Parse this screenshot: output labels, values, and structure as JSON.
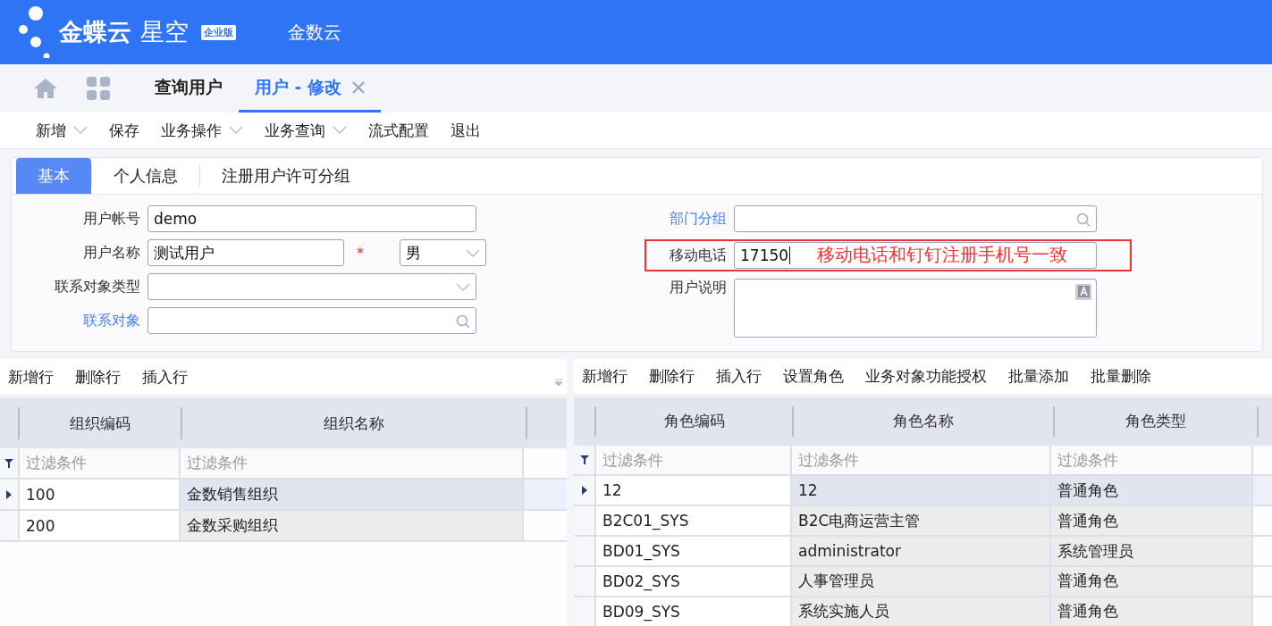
{
  "header": {
    "brand": "金蝶云",
    "product": "星空",
    "edition": "企业版",
    "org": "金数云"
  },
  "nav_tabs": [
    {
      "label": "查询用户",
      "selected": false,
      "closable": false
    },
    {
      "label": "用户 - 修改",
      "selected": true,
      "closable": true
    }
  ],
  "toolbar": [
    {
      "label": "新增",
      "dropdown": true
    },
    {
      "label": "保存",
      "dropdown": false
    },
    {
      "label": "业务操作",
      "dropdown": true
    },
    {
      "label": "业务查询",
      "dropdown": true
    },
    {
      "label": "流式配置",
      "dropdown": false
    },
    {
      "label": "退出",
      "dropdown": false
    }
  ],
  "form_tabs": [
    {
      "label": "基本",
      "selected": true
    },
    {
      "label": "个人信息",
      "selected": false
    },
    {
      "label": "注册用户许可分组",
      "selected": false
    }
  ],
  "form_left": [
    {
      "label": "用户帐号",
      "link": false,
      "kind": "text",
      "value": "demo"
    },
    {
      "label": "用户名称",
      "link": false,
      "kind": "text_with_select",
      "value": "测试用户",
      "required_mark": "*",
      "select_value": "男"
    },
    {
      "label": "联系对象类型",
      "link": false,
      "kind": "select"
    },
    {
      "label": "联系对象",
      "link": true,
      "kind": "lookup"
    }
  ],
  "form_right": [
    {
      "label": "部门分组",
      "link": true,
      "kind": "lookup"
    },
    {
      "label": "移动电话",
      "link": false,
      "kind": "annotated",
      "value": "17150",
      "annotation": "移动电话和钉钉注册手机号一致"
    },
    {
      "label": "用户说明",
      "link": false,
      "kind": "textarea"
    }
  ],
  "org_grid": {
    "toolbar": [
      "新增行",
      "删除行",
      "插入行"
    ],
    "columns": [
      "组织编码",
      "组织名称"
    ],
    "filters": [
      "过滤条件",
      "过滤条件"
    ],
    "rows": [
      {
        "cells": [
          "100",
          "金数销售组织"
        ],
        "selected": true
      },
      {
        "cells": [
          "200",
          "金数采购组织"
        ],
        "selected": false
      }
    ]
  },
  "role_grid": {
    "toolbar": [
      "新增行",
      "删除行",
      "插入行",
      "设置角色",
      "业务对象功能授权",
      "批量添加",
      "批量删除"
    ],
    "columns": [
      "角色编码",
      "角色名称",
      "角色类型"
    ],
    "filters": [
      "过滤条件",
      "过滤条件",
      "过滤条件"
    ],
    "rows": [
      {
        "cells": [
          "12",
          "12",
          "普通角色"
        ],
        "selected": true
      },
      {
        "cells": [
          "B2C01_SYS",
          "B2C电商运营主管",
          "普通角色"
        ],
        "selected": false
      },
      {
        "cells": [
          "BD01_SYS",
          "administrator",
          "系统管理员"
        ],
        "selected": false
      },
      {
        "cells": [
          "BD02_SYS",
          "人事管理员",
          "普通角色"
        ],
        "selected": false
      },
      {
        "cells": [
          "BD09_SYS",
          "系统实施人员",
          "普通角色"
        ],
        "selected": false
      }
    ]
  }
}
